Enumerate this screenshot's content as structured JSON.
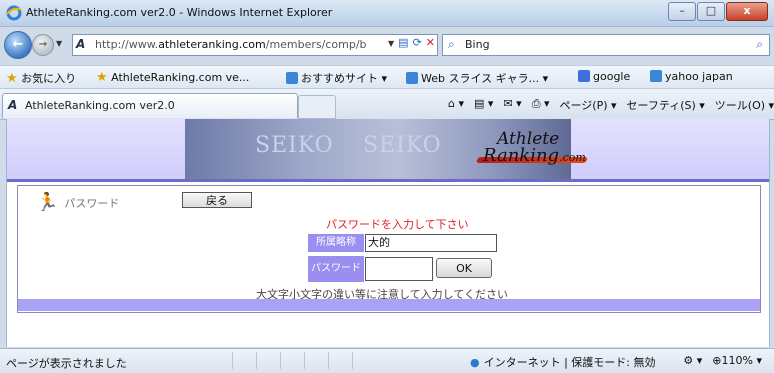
{
  "window": {
    "title": "AthleteRanking.com ver2.0 - Windows Internet Explorer",
    "buttons": {
      "minimize": "–",
      "maximize": "□",
      "close": "x"
    }
  },
  "address_bar": {
    "url_prefix": "http://www.",
    "url_domain": "athleteranking.com",
    "url_path": "/members/comp/b",
    "search_engine": "Bing"
  },
  "favorites_bar": {
    "label": "お気に入り",
    "items": [
      "AthleteRanking.com ve...",
      "おすすめサイト ▾",
      "Web スライス ギャラ... ▾",
      "google",
      "yahoo japan"
    ]
  },
  "tab": {
    "title": "AthleteRanking.com ver2.0"
  },
  "command_bar": {
    "page": "ページ(P) ▾",
    "safety": "セーフティ(S) ▾",
    "tools": "ツール(O) ▾"
  },
  "banner": {
    "ad_texts": [
      "SEIKO",
      "SEIKO"
    ],
    "logo_line1": "Athlete",
    "logo_line2": "Ranking",
    "logo_suffix": ".com"
  },
  "page": {
    "section_label": "パスワード",
    "back_button": "戻る",
    "message": "パスワードを入力して下さい",
    "org_label": "所属略称",
    "org_value": "大的",
    "password_label": "パスワード",
    "password_value": "",
    "ok_button": "OK",
    "note": "大文字小文字の違い等に注意して入力してください"
  },
  "status_bar": {
    "status": "ページが表示されました",
    "zone": "インターネット | 保護モード: 無効",
    "zoom": "110%"
  },
  "colors": {
    "accent_purple": "#9a8ef0",
    "message_red": "#e02020",
    "banner_lavender": "#cfcdfb"
  }
}
